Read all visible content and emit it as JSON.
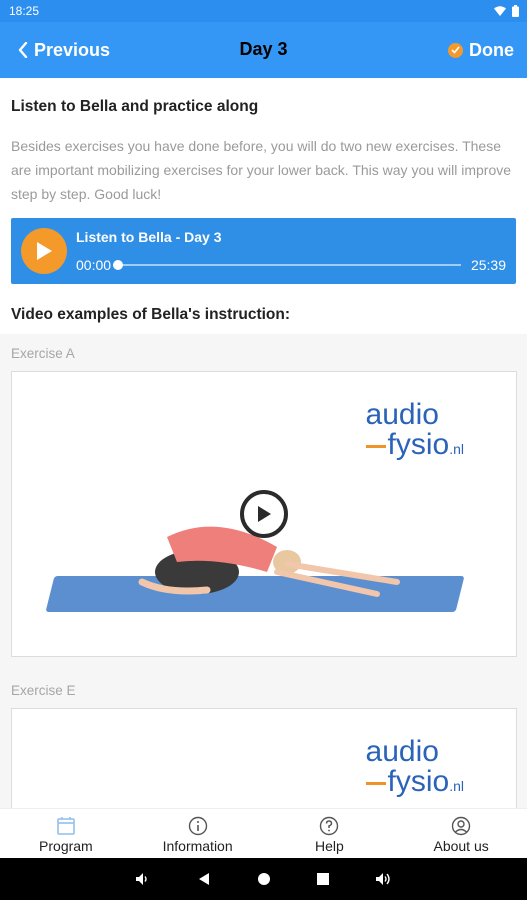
{
  "status_bar": {
    "time": "18:25"
  },
  "nav": {
    "back_label": "Previous",
    "title": "Day 3",
    "done_label": "Done"
  },
  "intro": {
    "heading": "Listen to Bella and practice along",
    "description": "Besides exercises you have done before, you will do two new exercises. These are important mobilizing exercises for your lower back. This way you will improve step by step. Good luck!"
  },
  "player": {
    "title": "Listen to Bella - Day 3",
    "current_time": "00:00",
    "duration": "25:39",
    "progress": 0
  },
  "videos": {
    "heading": "Video examples of Bella's instruction:",
    "items": [
      {
        "label": "Exercise A"
      },
      {
        "label": "Exercise E"
      }
    ]
  },
  "logo": {
    "line1": "audio",
    "line2": "fysio",
    "suffix": ".nl"
  },
  "tabs": [
    {
      "label": "Program",
      "icon": "calendar-icon"
    },
    {
      "label": "Information",
      "icon": "info-icon"
    },
    {
      "label": "Help",
      "icon": "help-icon"
    },
    {
      "label": "About us",
      "icon": "person-icon"
    }
  ],
  "colors": {
    "primary": "#3597f5",
    "accent": "#f39a2b",
    "player_bg": "#2f8fe6",
    "active_tab_icon": "#9ec6ee"
  }
}
